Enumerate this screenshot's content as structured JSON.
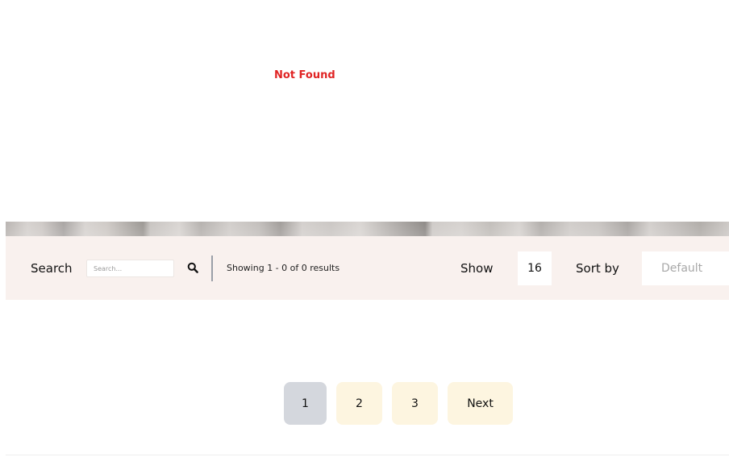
{
  "message": {
    "not_found": "Not Found"
  },
  "filter_bar": {
    "search_label": "Search",
    "search_placeholder": "Search...",
    "search_value": "",
    "results_text": "Showing 1 - 0 of 0 results",
    "show_label": "Show",
    "show_count": "16",
    "sort_label": "Sort by",
    "sort_value": "Default"
  },
  "pagination": {
    "pages": [
      "1",
      "2",
      "3"
    ],
    "current": "1",
    "next_label": "Next"
  },
  "colors": {
    "not_found": "#e02424",
    "filter_bar_bg": "#f9f1ee",
    "page_active_bg": "#d4d7dd",
    "page_inactive_bg": "#fdf5e0"
  },
  "icons": {
    "search": "search-icon"
  }
}
